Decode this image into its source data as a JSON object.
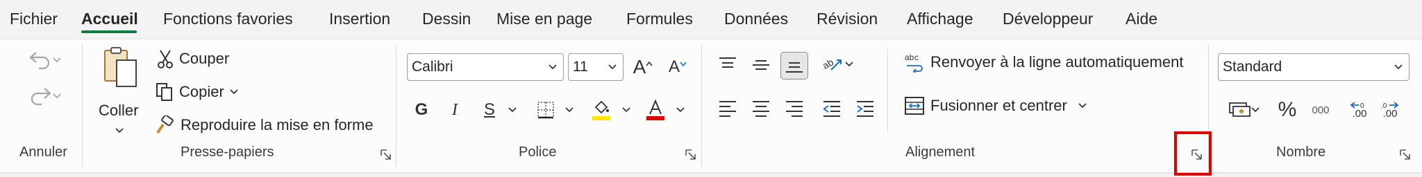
{
  "tabs": [
    "Fichier",
    "Accueil",
    "Fonctions favories",
    "Insertion",
    "Dessin",
    "Mise en page",
    "Formules",
    "Données",
    "Révision",
    "Affichage",
    "Développeur",
    "Aide"
  ],
  "active_tab": "Accueil",
  "groups": {
    "annuler": {
      "label": "Annuler"
    },
    "presse_papiers": {
      "label": "Presse-papiers",
      "paste": "Coller",
      "cut": "Couper",
      "copy": "Copier",
      "format_painter": "Reproduire la mise en forme"
    },
    "police": {
      "label": "Police",
      "font_name": "Calibri",
      "font_size": "11",
      "bold": "G",
      "italic": "I",
      "underline": "S",
      "grow": "A",
      "shrink": "A"
    },
    "alignement": {
      "label": "Alignement",
      "wrap": "Renvoyer à la ligne automatiquement",
      "merge": "Fusionner et centrer"
    },
    "nombre": {
      "label": "Nombre",
      "format": "Standard",
      "percent": "%",
      "thousands": "000",
      "inc_decimal": ".00",
      "dec_decimal": ".00"
    }
  },
  "colors": {
    "accent_green": "#107c41",
    "highlight_yellow": "#ffe600",
    "font_red": "#e00000",
    "annotation_red": "#e00000"
  }
}
